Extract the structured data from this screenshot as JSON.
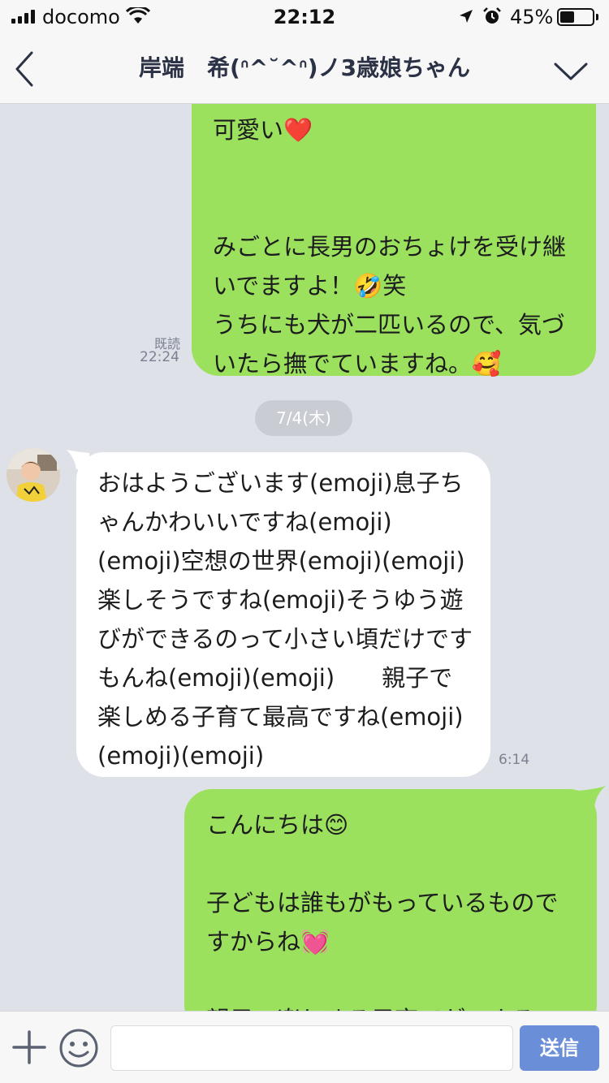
{
  "status_bar": {
    "carrier": "docomo",
    "time": "22:12",
    "battery_percent": "45%",
    "battery_level": 0.45
  },
  "header": {
    "title": "岸端　希(ᐢ^˘^ᐢ)ノ3歳娘ちゃん",
    "back_icon": "chevron-left-icon",
    "menu_icon": "chevron-down-icon"
  },
  "messages": [
    {
      "direction": "outgoing",
      "text": "可愛い❤️\n\n\nみごとに長男のおちょけを受け継いでますよ！🤣笑\nうちにも犬が二匹いるので、気づいたら撫でていますね。🥰",
      "read_label": "既読",
      "time": "22:24"
    },
    {
      "direction": "incoming",
      "text": "おはようございます(emoji)息子ちゃんかわいいですね(emoji)(emoji)空想の世界(emoji)(emoji) 楽しそうですね(emoji)そうゆう遊びができるのって小さい頃だけですもんね(emoji)(emoji)　　親子で楽しめる子育て最高ですね(emoji)(emoji)(emoji)",
      "time": "6:14"
    },
    {
      "direction": "outgoing",
      "text": "こんにちは😊\n\n子どもは誰もがもっているものですからね💓\n\n親子で楽しめる子育てができる"
    }
  ],
  "date_separator": "7/4(木)",
  "input_bar": {
    "placeholder": "",
    "send_label": "送信",
    "plus_icon": "plus-icon",
    "sticker_icon": "smiley-icon"
  },
  "colors": {
    "outgoing_bubble": "#9be15d",
    "incoming_bubble": "#ffffff",
    "background": "#dee1e7",
    "send_button": "#6a8fd8"
  }
}
